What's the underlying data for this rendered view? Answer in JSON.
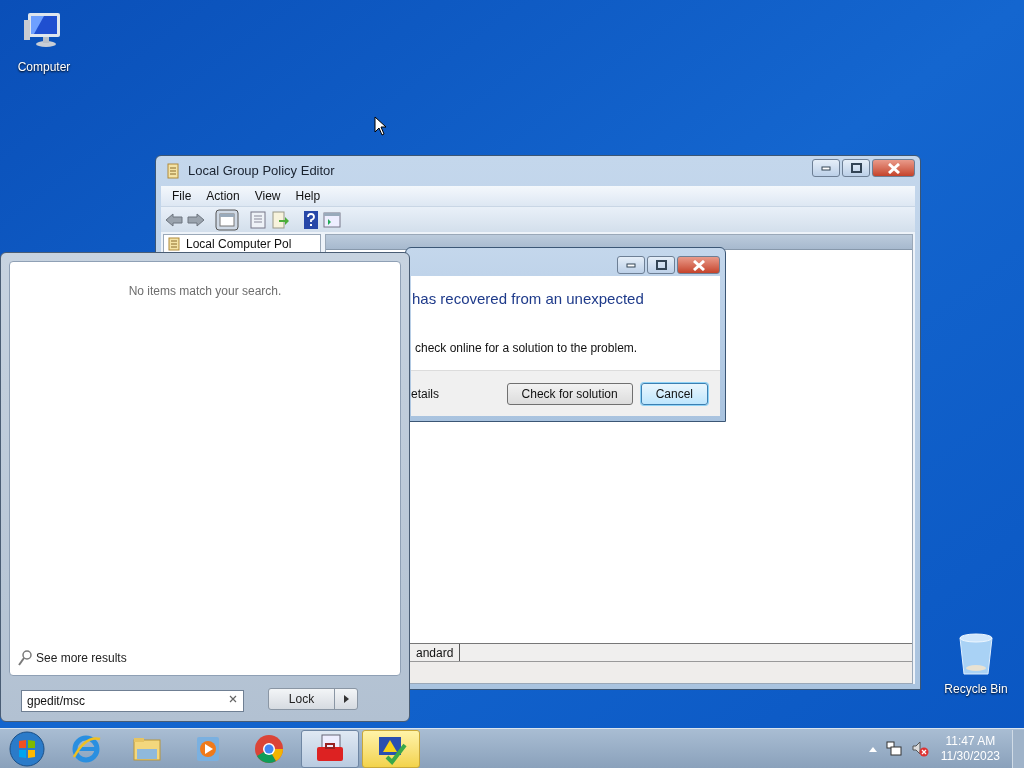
{
  "desktop_icons": [
    {
      "kind": "computer",
      "label": "Computer"
    },
    {
      "kind": "recycle",
      "label": "Recycle Bin"
    }
  ],
  "editor_window": {
    "title": "Local Group Policy Editor",
    "menu": [
      "File",
      "Action",
      "View",
      "Help"
    ],
    "tree_item": "Local Computer Pol",
    "tab": "andard"
  },
  "error_dialog": {
    "heading": "has recovered from an unexpected",
    "message": "check online for a solution to the problem.",
    "details": "etails",
    "buttons": [
      {
        "label": "Check for solution",
        "selected": false
      },
      {
        "label": "Cancel",
        "selected": true
      }
    ]
  },
  "start_menu": {
    "empty_message": "No items match your search.",
    "more_results": "See more results",
    "search": {
      "value": "gpedit/msc"
    },
    "power_button": "Lock"
  },
  "taskbar": {
    "apps": [
      {
        "kind": "ie",
        "open": false
      },
      {
        "kind": "folder",
        "open": false
      },
      {
        "kind": "media",
        "open": false
      },
      {
        "kind": "chrome",
        "open": false
      },
      {
        "kind": "toolbox",
        "open": true
      },
      {
        "kind": "alert",
        "open": true
      }
    ],
    "time": "11:47 AM",
    "date": "11/30/2023"
  }
}
